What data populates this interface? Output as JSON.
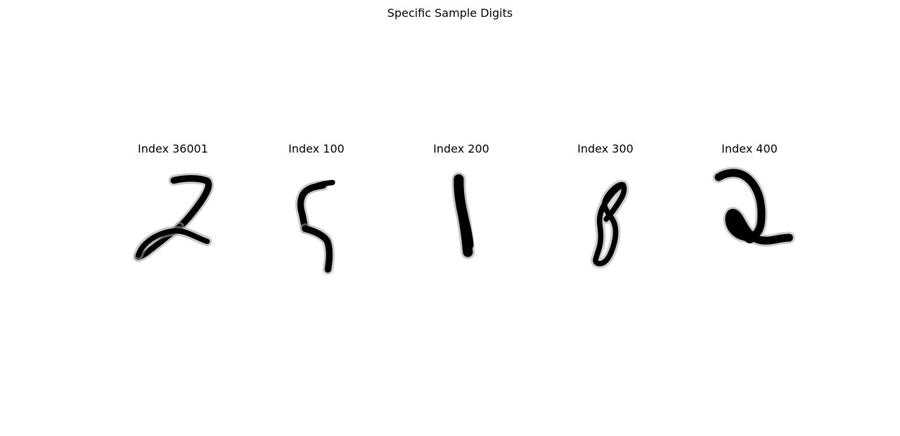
{
  "figure": {
    "title": "Specific Sample Digits"
  },
  "panels": [
    {
      "title": "Index 36001",
      "digit": "2"
    },
    {
      "title": "Index 100",
      "digit": "5"
    },
    {
      "title": "Index 200",
      "digit": "1"
    },
    {
      "title": "Index 300",
      "digit": "8"
    },
    {
      "title": "Index 400",
      "digit": "2"
    }
  ],
  "colormap": {
    "ink": "#000000",
    "background": "#ffffff"
  }
}
